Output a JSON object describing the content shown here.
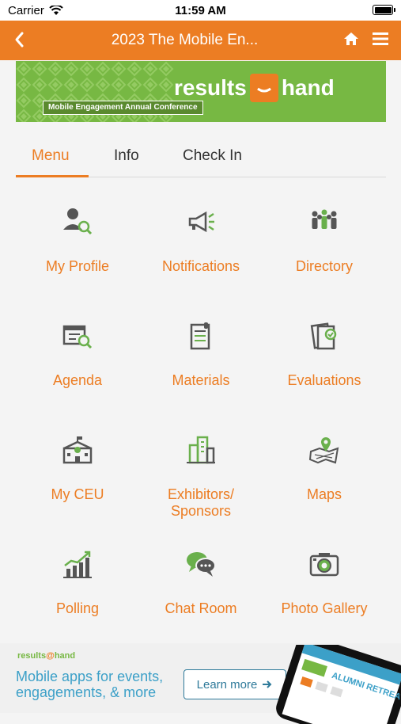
{
  "status_bar": {
    "carrier": "Carrier",
    "time": "11:59 AM"
  },
  "navbar": {
    "title": "2023 The Mobile En..."
  },
  "banner": {
    "brand_left": "results",
    "brand_right": "hand",
    "conference": "Mobile Engagement Annual Conference"
  },
  "tabs": [
    {
      "label": "Menu"
    },
    {
      "label": "Info"
    },
    {
      "label": "Check In"
    }
  ],
  "menu": [
    {
      "label": "My Profile"
    },
    {
      "label": "Notifications"
    },
    {
      "label": "Directory"
    },
    {
      "label": "Agenda"
    },
    {
      "label": "Materials"
    },
    {
      "label": "Evaluations"
    },
    {
      "label": "My CEU"
    },
    {
      "label": "Exhibitors/ Sponsors"
    },
    {
      "label": "Maps"
    },
    {
      "label": "Polling"
    },
    {
      "label": "Chat Room"
    },
    {
      "label": "Photo Gallery"
    }
  ],
  "ad": {
    "brand_left": "results",
    "brand_right": "hand",
    "line1": "Mobile apps for events,",
    "line2": "engagements, & more",
    "cta": "Learn more",
    "screen_text": "ALUMNI RETREAT"
  },
  "colors": {
    "brand_orange": "#ec7d23",
    "brand_green": "#77b843",
    "ad_blue": "#3ca0c8"
  }
}
